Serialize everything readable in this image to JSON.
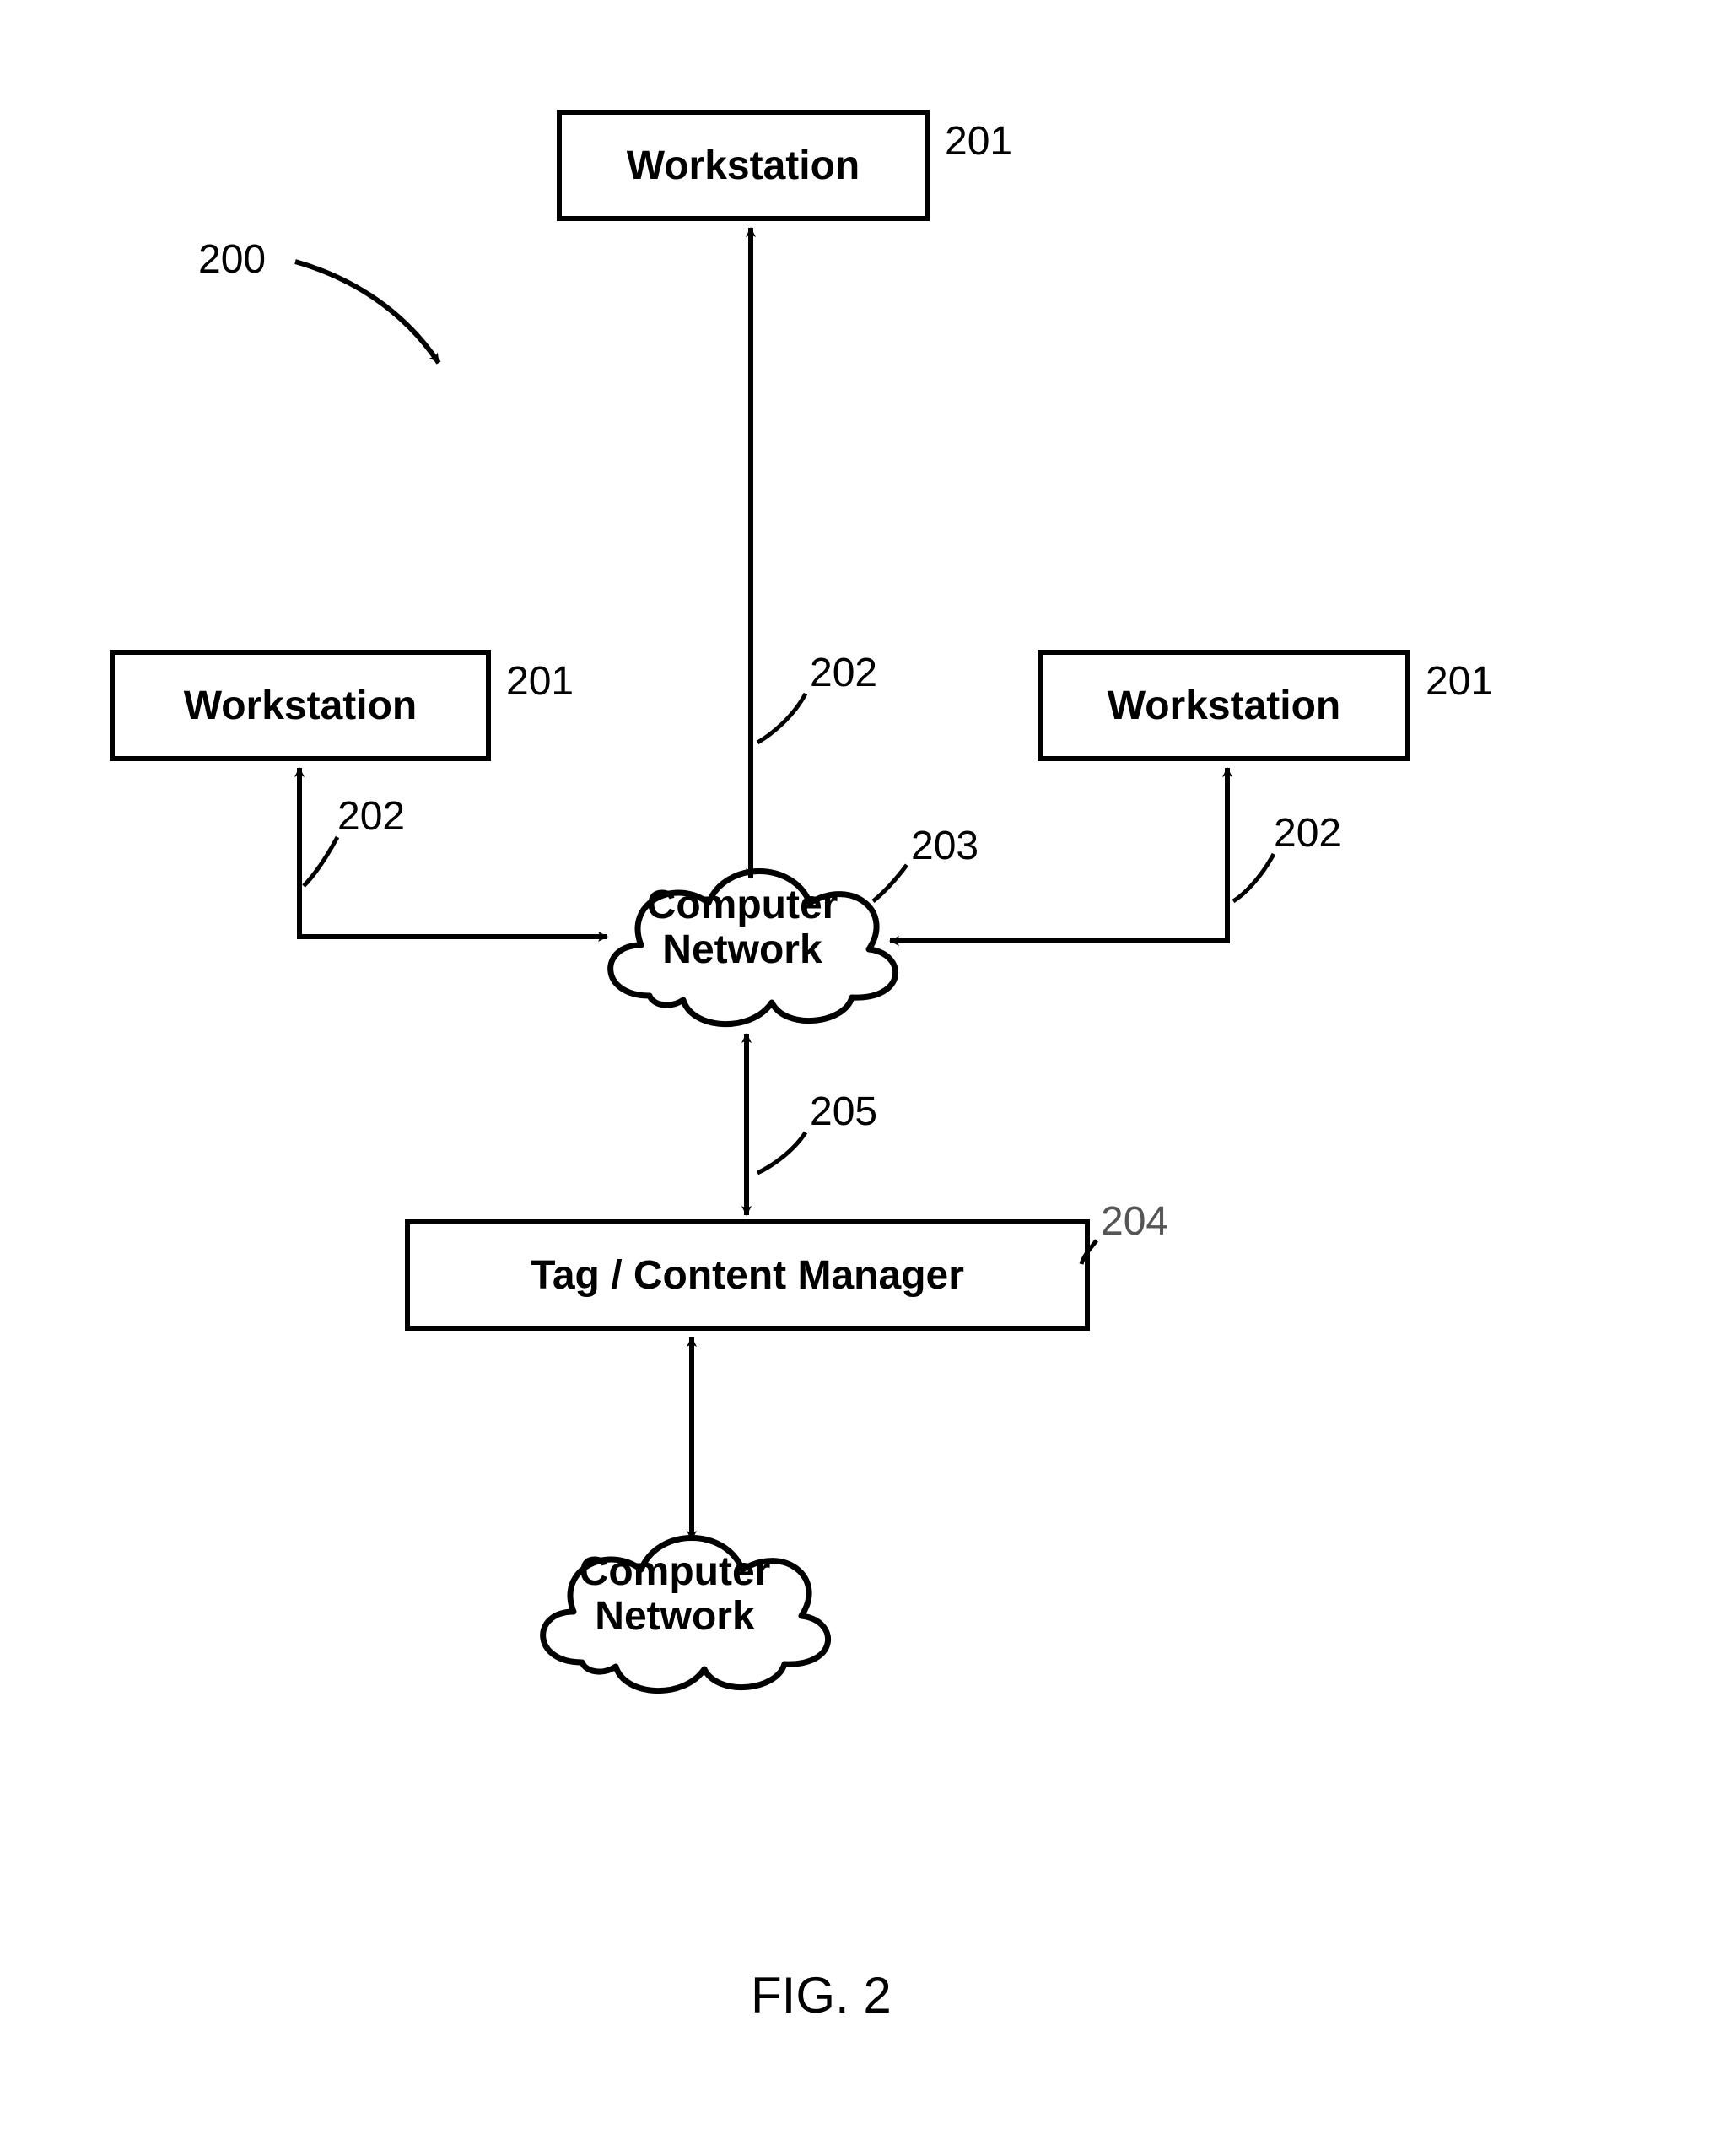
{
  "figure": {
    "caption": "FIG. 2",
    "ref_system": "200"
  },
  "nodes": {
    "workstation_top": {
      "label": "Workstation",
      "ref": "201"
    },
    "workstation_left": {
      "label": "Workstation",
      "ref": "201"
    },
    "workstation_right": {
      "label": "Workstation",
      "ref": "201"
    },
    "network_upper": {
      "label": "Computer\nNetwork",
      "ref": "203"
    },
    "network_lower": {
      "label": "Computer\nNetwork"
    },
    "tag_manager": {
      "label": "Tag / Content Manager",
      "ref": "204"
    }
  },
  "links": {
    "top_to_network": {
      "ref": "202"
    },
    "left_to_network": {
      "ref": "202"
    },
    "right_to_network": {
      "ref": "202"
    },
    "network_to_manager": {
      "ref": "205"
    }
  }
}
